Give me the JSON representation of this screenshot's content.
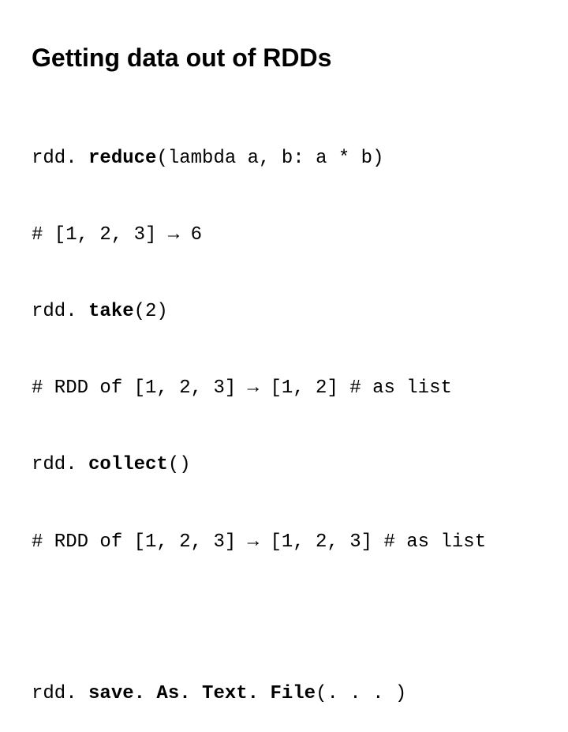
{
  "title": "Getting data out of RDDs",
  "lines": [
    {
      "prefix": "rdd. ",
      "bold": "reduce",
      "suffix": "(lambda a, b: a * b)"
    },
    {
      "prefix": "# [1, 2, 3] → 6",
      "bold": "",
      "suffix": ""
    },
    {
      "prefix": "rdd. ",
      "bold": "take",
      "suffix": "(2)"
    },
    {
      "prefix": "# RDD of [1, 2, 3] → [1, 2] # as list",
      "bold": "",
      "suffix": ""
    },
    {
      "prefix": "rdd. ",
      "bold": "collect",
      "suffix": "()"
    },
    {
      "prefix": "# RDD of [1, 2, 3] → [1, 2, 3] # as list",
      "bold": "",
      "suffix": ""
    }
  ],
  "footer": {
    "prefix": "rdd. ",
    "bold": "save. As. Text. File",
    "suffix": "(. . . )"
  }
}
